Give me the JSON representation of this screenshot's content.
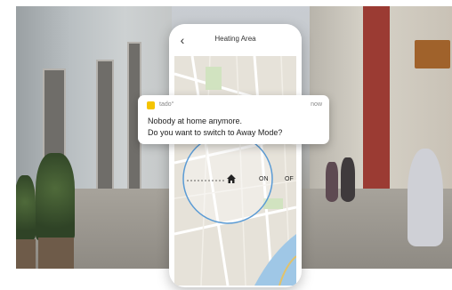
{
  "phone": {
    "title": "Heating Area",
    "toggle_on": "ON",
    "toggle_off": "OF"
  },
  "notification": {
    "app_name": "tado°",
    "time": "now",
    "line1": "Nobody at home anymore.",
    "line2": "Do you want to switch to Away Mode?"
  },
  "colors": {
    "app_accent": "#f5c400",
    "geofence": "#5a9bd5",
    "map_water": "#9fc7e6"
  },
  "icons": [
    "back-icon",
    "home-icon"
  ]
}
